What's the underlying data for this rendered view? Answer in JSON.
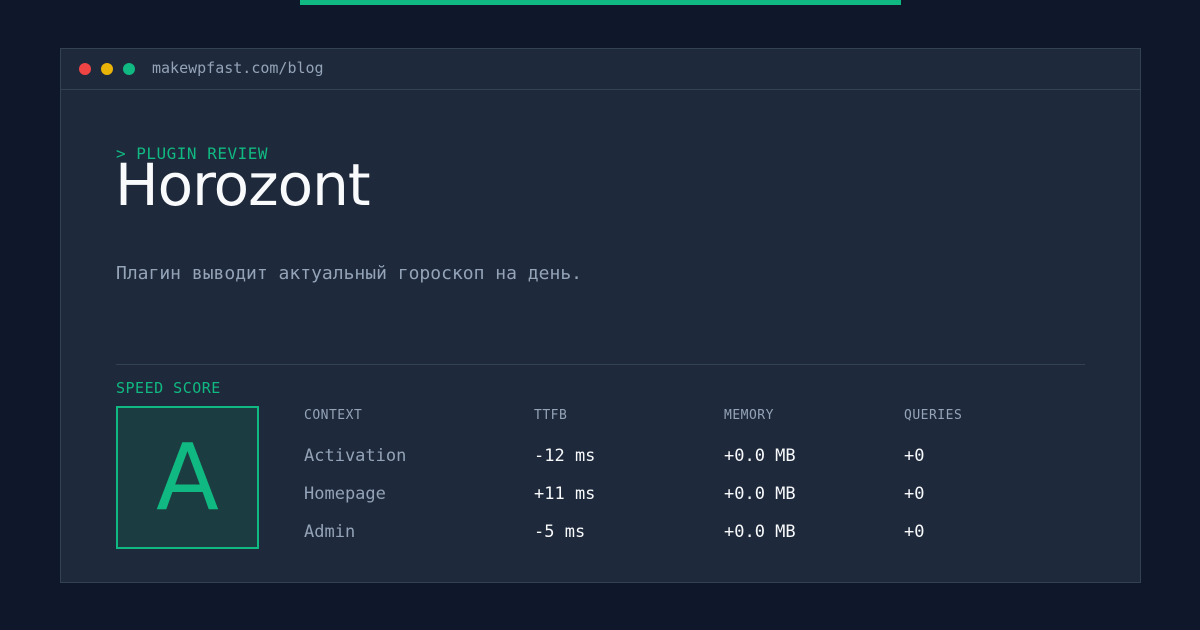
{
  "window": {
    "url": "makewpfast.com/blog"
  },
  "card": {
    "eyebrow": "> PLUGIN REVIEW",
    "title": "Horozont",
    "description": "Плагин выводит актуальный гороскоп на день."
  },
  "speed": {
    "label": "SPEED SCORE",
    "grade": "A",
    "columns": [
      "CONTEXT",
      "TTFB",
      "MEMORY",
      "QUERIES"
    ],
    "rows": [
      {
        "context": "Activation",
        "ttfb": "-12 ms",
        "memory": "+0.0 MB",
        "queries": "+0"
      },
      {
        "context": "Homepage",
        "ttfb": "+11 ms",
        "memory": "+0.0 MB",
        "queries": "+0"
      },
      {
        "context": "Admin",
        "ttfb": "-5 ms",
        "memory": "+0.0 MB",
        "queries": "+0"
      }
    ]
  },
  "colors": {
    "background": "#0f172a",
    "panel": "#1e293b",
    "accent": "#10b981",
    "muted_text": "#94a3b8",
    "bright_text": "#f8fafc"
  }
}
